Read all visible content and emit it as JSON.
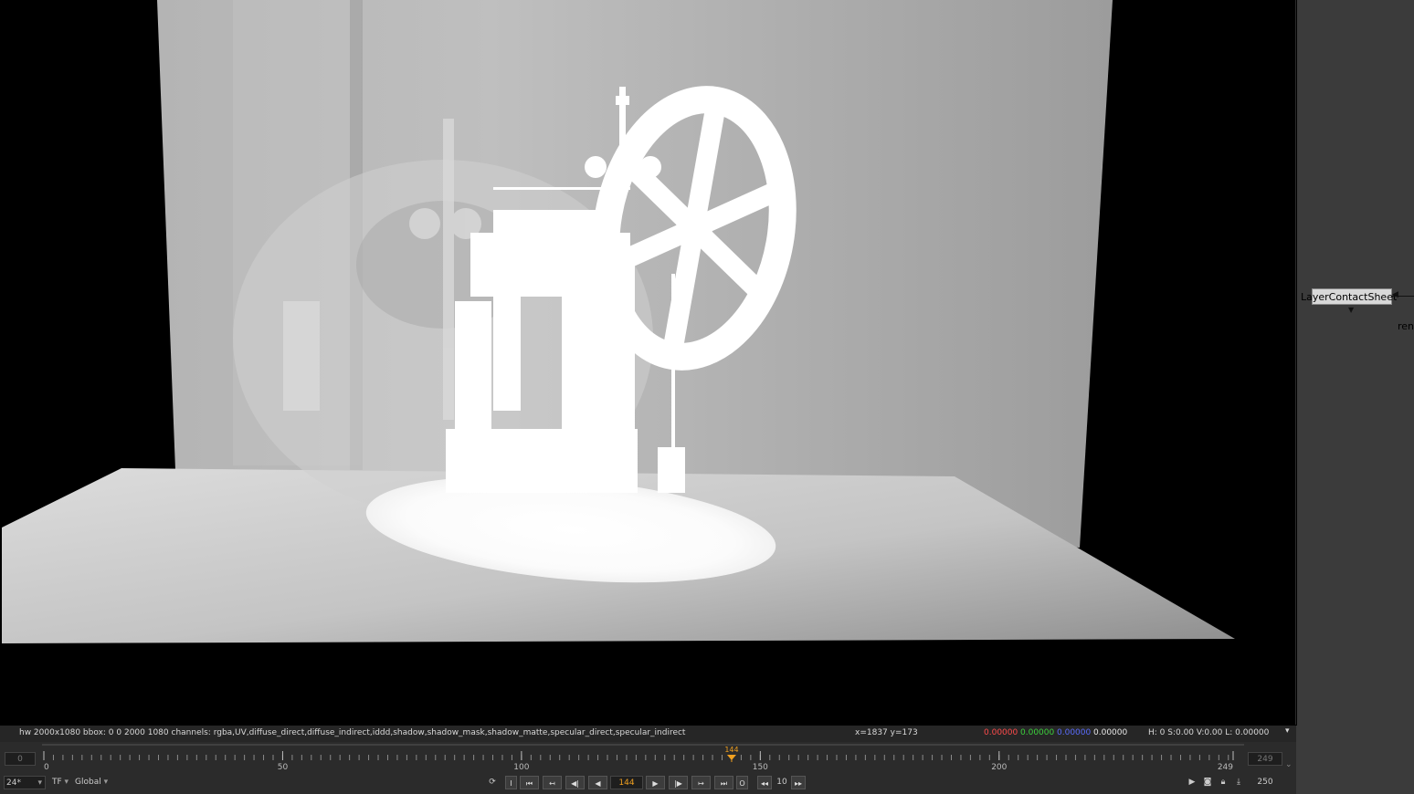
{
  "viewer": {
    "info": {
      "format": "hw 2000x1080  bbox: 0 0 2000 1080 channels: rgba,UV,diffuse_direct,diffuse_indirect,iddd,shadow,shadow_mask,shadow_matte,specular_direct,specular_indirect",
      "coords": "x=1837 y=173",
      "r": "0.00000",
      "g": "0.00000",
      "b": "0.00000",
      "a": "0.00000",
      "hsv": "H:  0 S:0.00 V:0.00  L: 0.00000",
      "colors": {
        "r": "#ff4b4b",
        "g": "#3cd23c",
        "b": "#5a6cff"
      }
    },
    "menu_icon": "▾"
  },
  "node_graph": {
    "node_label": "LayerContactSheet",
    "sub_label": "ren",
    "node_color": "#d8d8d8",
    "bg_color": "#3b3b3b"
  },
  "timeline": {
    "start_frame": "0",
    "end_frame": "249",
    "current_frame": 144,
    "current_label": "144",
    "range": [
      0,
      249
    ],
    "ticks": [
      {
        "value": 0,
        "label": "0"
      },
      {
        "value": 50,
        "label": "50"
      },
      {
        "value": 100,
        "label": "100"
      },
      {
        "value": 150,
        "label": "150"
      },
      {
        "value": 200,
        "label": "200"
      },
      {
        "value": 249,
        "label": "249"
      }
    ],
    "playhead_color": "#f0a020"
  },
  "transport": {
    "fps": "24*",
    "tf": "TF",
    "range_mode": "Global",
    "frame": "144",
    "increment": "10",
    "end": "250",
    "buttons": {
      "in_point": "I",
      "first": "⏮",
      "prev_key": "↤",
      "prev_frame": "◀|",
      "play_back": "◀",
      "play_fwd": "▶",
      "next_frame": "|▶",
      "next_key": "↦",
      "last": "⏭",
      "out_point": "O",
      "skip_back": "◂◂",
      "skip_fwd": "▸▸"
    }
  }
}
